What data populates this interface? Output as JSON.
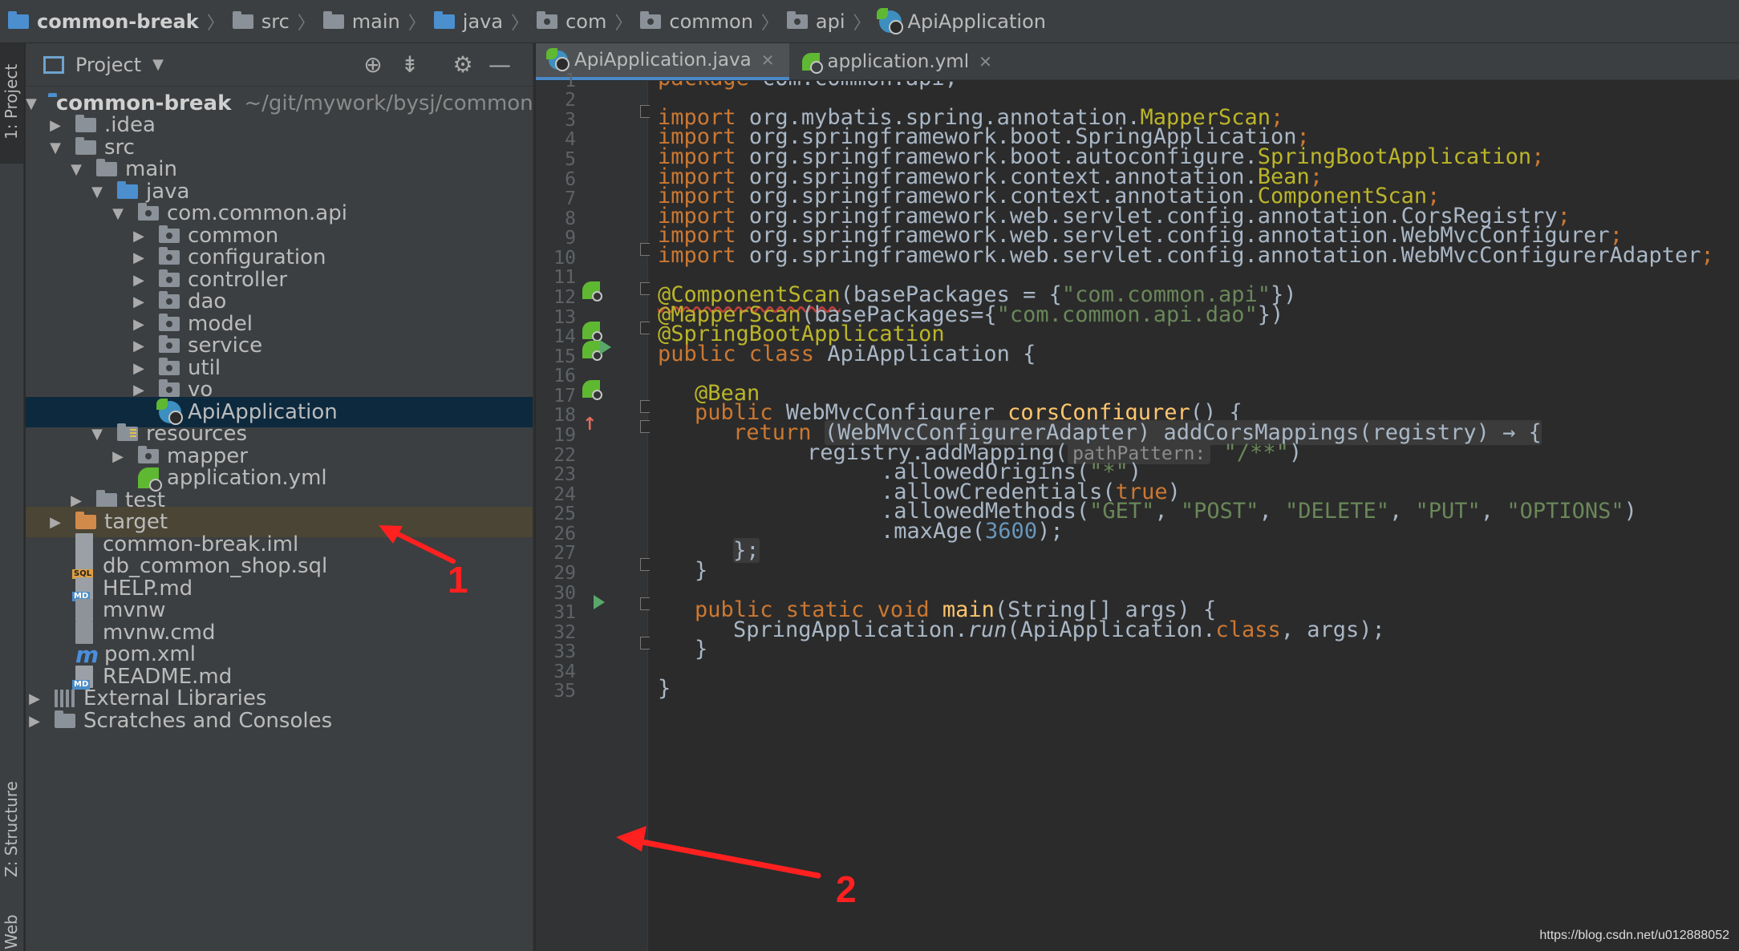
{
  "breadcrumb": [
    "common-break",
    "src",
    "main",
    "java",
    "com",
    "common",
    "api",
    "ApiApplication"
  ],
  "tool_strip": {
    "project": "1: Project",
    "structure": "Z: Structure",
    "web": "Web"
  },
  "project_panel": {
    "title": "Project"
  },
  "tree": [
    {
      "label": "common-break",
      "sub": "~/git/mywork/bysj/common-"
    },
    {
      "label": ".idea"
    },
    {
      "label": "src"
    },
    {
      "label": "main"
    },
    {
      "label": "java"
    },
    {
      "label": "com.common.api"
    },
    {
      "label": "common"
    },
    {
      "label": "configuration"
    },
    {
      "label": "controller"
    },
    {
      "label": "dao"
    },
    {
      "label": "model"
    },
    {
      "label": "service"
    },
    {
      "label": "util"
    },
    {
      "label": "vo"
    },
    {
      "label": "ApiApplication"
    },
    {
      "label": "resources"
    },
    {
      "label": "mapper"
    },
    {
      "label": "application.yml"
    },
    {
      "label": "test"
    },
    {
      "label": "target"
    },
    {
      "label": "common-break.iml"
    },
    {
      "label": "db_common_shop.sql",
      "tag": "SQL"
    },
    {
      "label": "HELP.md",
      "tag": "MD"
    },
    {
      "label": "mvnw"
    },
    {
      "label": "mvnw.cmd"
    },
    {
      "label": "pom.xml",
      "icon_glyph": "m"
    },
    {
      "label": "README.md",
      "tag": "MD"
    },
    {
      "label": "External Libraries"
    },
    {
      "label": "Scratches and Consoles"
    }
  ],
  "tabs": [
    {
      "label": "ApiApplication.java",
      "active": true
    },
    {
      "label": "application.yml",
      "active": false
    }
  ],
  "line_numbers": [
    "1",
    "2",
    "3",
    "4",
    "5",
    "6",
    "7",
    "8",
    "9",
    "10",
    "11",
    "12",
    "13",
    "14",
    "15",
    "16",
    "17",
    "18",
    "19",
    "22",
    "23",
    "24",
    "25",
    "26",
    "27",
    "29",
    "30",
    "31",
    "32",
    "33",
    "34",
    "35"
  ],
  "code": {
    "l1": [
      "package",
      " com.common.api;"
    ],
    "imports": [
      [
        "org.mybatis.spring.annotation.",
        "MapperScan",
        ";"
      ],
      [
        "org.springframework.boot.",
        "SpringApplication",
        ";"
      ],
      [
        "org.springframework.boot.autoconfigure.",
        "SpringBootApplication",
        ";"
      ],
      [
        "org.springframework.context.annotation.",
        "Bean",
        ";"
      ],
      [
        "org.springframework.context.annotation.",
        "ComponentScan",
        ";"
      ],
      [
        "org.springframework.web.servlet.config.annotation.",
        "CorsRegistry",
        ";"
      ],
      [
        "org.springframework.web.servlet.config.annotation.",
        "WebMvcConfigurer",
        ";"
      ],
      [
        "org.springframework.web.servlet.config.annotation.",
        "WebMvcConfigurerAdapter",
        ";"
      ]
    ],
    "import_kw": "import",
    "l12": [
      "@ComponentScan",
      "(basePackages = {",
      "\"com.common.api\"",
      "})"
    ],
    "l13": [
      "@MapperScan",
      "(basePackages={",
      "\"com.common.api.dao\"",
      "})"
    ],
    "l14": "@SpringBootApplication",
    "l15": [
      "public class",
      " ApiApplication {"
    ],
    "l17": "@Bean",
    "l18": [
      "public",
      " WebMvcConfigurer ",
      "corsConfigurer",
      "() {"
    ],
    "l19": [
      "return",
      " ",
      "(WebMvcConfigurerAdapter) addCorsMappings(registry) → {"
    ],
    "l22": [
      "registry.addMapping(",
      "pathPattern:",
      " ",
      "\"/**\"",
      ")"
    ],
    "l23": [
      ".allowedOrigins(",
      "\"*\"",
      ")"
    ],
    "l24": [
      ".allowCredentials(",
      "true",
      ")"
    ],
    "l25": [
      ".allowedMethods(",
      "\"GET\"",
      ", ",
      "\"POST\"",
      ", ",
      "\"DELETE\"",
      ", ",
      "\"PUT\"",
      ", ",
      "\"OPTIONS\"",
      ")"
    ],
    "l26": [
      ".maxAge(",
      "3600",
      ");"
    ],
    "l27": "};",
    "l29": "}",
    "l31": [
      "public static void",
      " ",
      "main",
      "(String[] args) {"
    ],
    "l32": [
      "SpringApplication.",
      "run",
      "(ApiApplication.",
      "class",
      ", args);"
    ],
    "l33": "}",
    "l35": "}"
  },
  "annotations": {
    "marker1": "1",
    "marker2": "2",
    "color": "#ff2020"
  },
  "watermark": "https://blog.csdn.net/u012888052"
}
